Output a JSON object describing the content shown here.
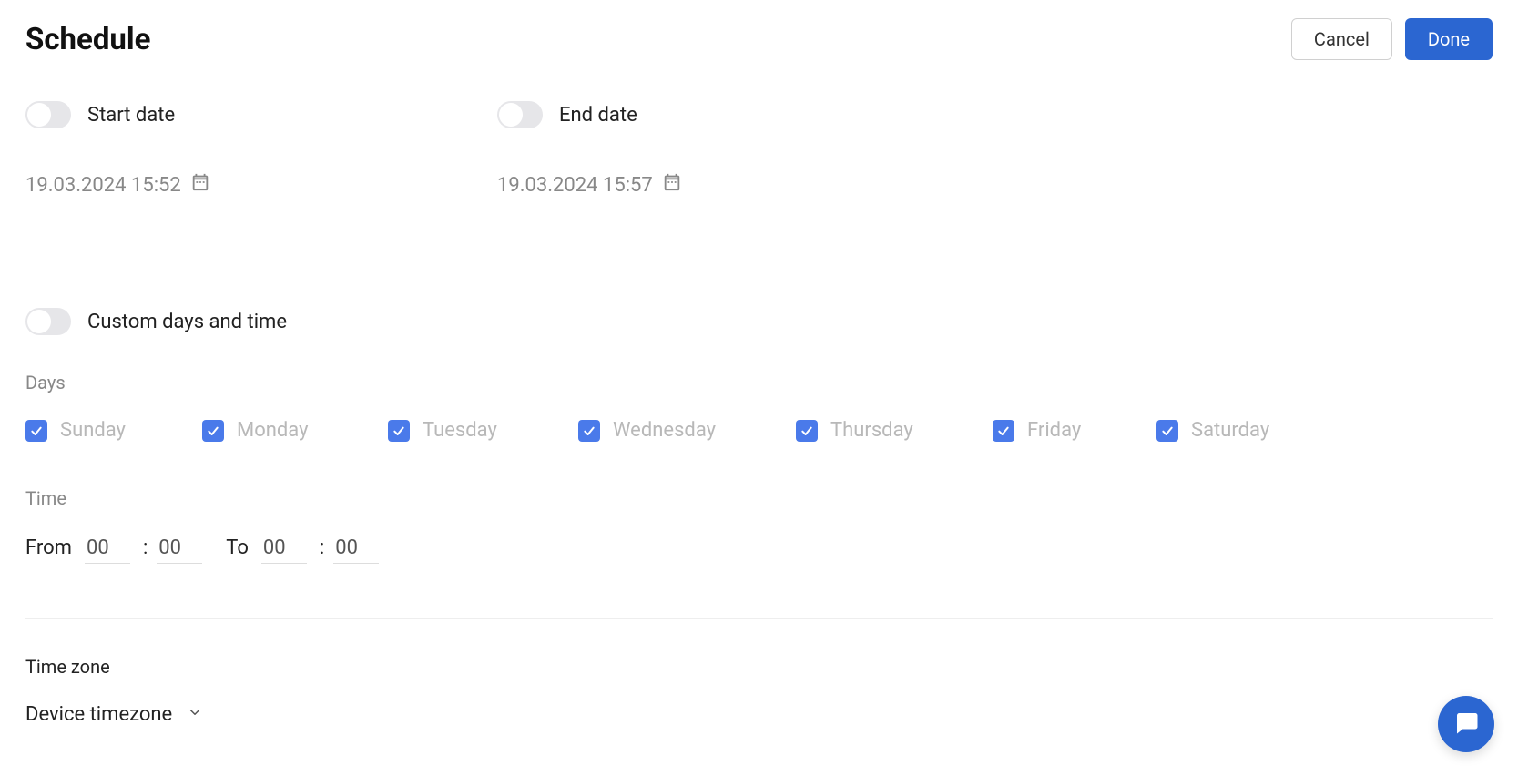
{
  "header": {
    "title": "Schedule",
    "cancel": "Cancel",
    "done": "Done"
  },
  "dates": {
    "start": {
      "label": "Start date",
      "value": "19.03.2024 15:52"
    },
    "end": {
      "label": "End date",
      "value": "19.03.2024 15:57"
    }
  },
  "custom": {
    "label": "Custom days and time",
    "daysLabel": "Days",
    "days": [
      {
        "name": "Sunday",
        "checked": true
      },
      {
        "name": "Monday",
        "checked": true
      },
      {
        "name": "Tuesday",
        "checked": true
      },
      {
        "name": "Wednesday",
        "checked": true
      },
      {
        "name": "Thursday",
        "checked": true
      },
      {
        "name": "Friday",
        "checked": true
      },
      {
        "name": "Saturday",
        "checked": true
      }
    ],
    "timeLabel": "Time",
    "fromLabel": "From",
    "toLabel": "To",
    "fromH": "00",
    "fromM": "00",
    "toH": "00",
    "toM": "00"
  },
  "timezone": {
    "label": "Time zone",
    "selected": "Device timezone"
  }
}
